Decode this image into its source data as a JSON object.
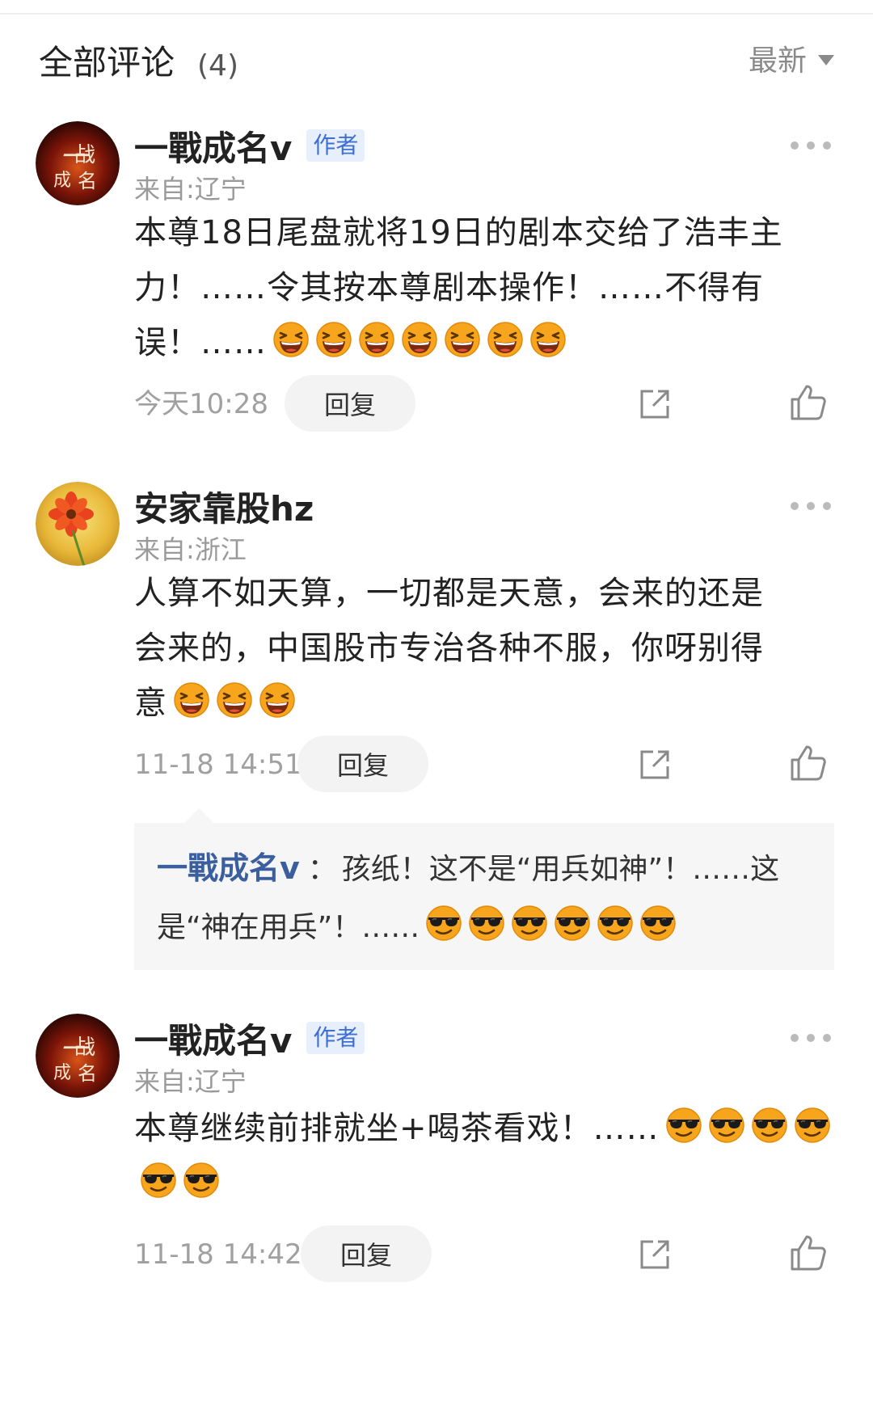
{
  "header": {
    "title": "全部评论",
    "count": "(4)",
    "sort_label": "最新"
  },
  "comments": [
    {
      "username": "一戰成名v",
      "badge": "作者",
      "location": "来自:辽宁",
      "text_line1": "本尊18日尾盘就将19日的剧本交给了浩丰主",
      "text_line2": "力！……令其按本尊剧本操作！……不得有",
      "text_line3": "误！……",
      "emoji_name": "laughing-emoji",
      "emoji_count": 7,
      "timestamp": "今天10:28",
      "reply_label": "回复"
    },
    {
      "username": "安家靠股hz",
      "location": "来自:浙江",
      "text_line1": "人算不如天算，一切都是天意，会来的还是",
      "text_line2": "会来的，中国股市专治各种不服，你呀别得",
      "text_line3": "意",
      "emoji_name": "laughing-emoji",
      "emoji_count": 3,
      "timestamp": "11-18 14:51",
      "reply_label": "回复",
      "sub_reply": {
        "user": "一戰成名v",
        "separator": "：",
        "line1": "孩纸！这不是“用兵如神”！……这",
        "line2": "是“神在用兵”！……",
        "emoji_name": "sunglasses-emoji",
        "emoji_count": 6
      }
    },
    {
      "username": "一戰成名v",
      "badge": "作者",
      "location": "来自:辽宁",
      "text_line1": "本尊继续前排就坐+喝茶看戏！……",
      "emoji_name": "sunglasses-emoji",
      "emoji_count": 6,
      "timestamp": "11-18 14:42",
      "reply_label": "回复"
    }
  ],
  "colors": {
    "badge_bg": "#e7eefc",
    "badge_text": "#3d6fd6",
    "sub_user": "#3b5e9e",
    "emoji_face": "#f7a51c"
  }
}
